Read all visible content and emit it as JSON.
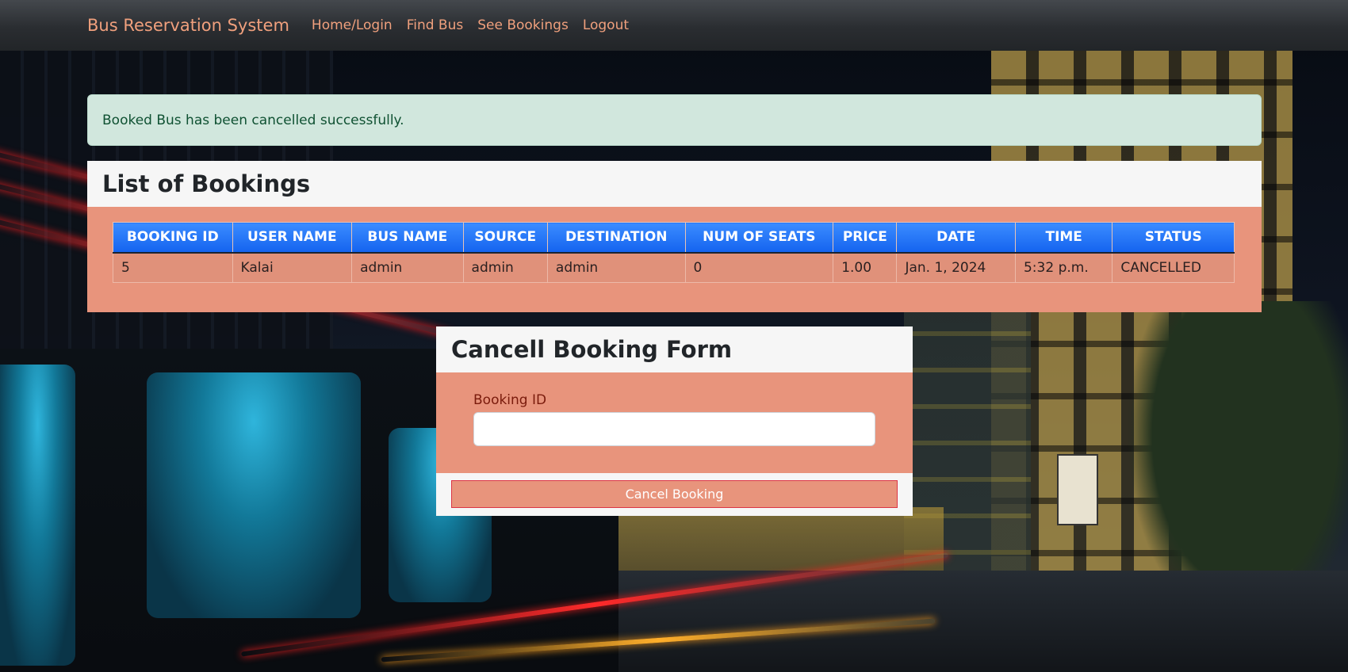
{
  "navbar": {
    "brand": "Bus Reservation System",
    "links": [
      "Home/Login",
      "Find Bus",
      "See Bookings",
      "Logout"
    ]
  },
  "alert": {
    "message": "Booked Bus has been cancelled successfully."
  },
  "bookings": {
    "title": "List of Bookings",
    "columns": [
      "BOOKING ID",
      "USER NAME",
      "BUS NAME",
      "SOURCE",
      "DESTINATION",
      "NUM OF SEATS",
      "PRICE",
      "DATE",
      "TIME",
      "STATUS"
    ],
    "rows": [
      [
        "5",
        "Kalai",
        "admin",
        "admin",
        "admin",
        "0",
        "1.00",
        "Jan. 1, 2024",
        "5:32 p.m.",
        "CANCELLED"
      ]
    ]
  },
  "cancel_form": {
    "title": "Cancell Booking Form",
    "field_label": "Booking ID",
    "field_value": "",
    "button_label": "Cancel Booking"
  },
  "colors": {
    "navbar_link": "#f0a07d",
    "card_body": "#e8947c",
    "table_header": "#1463ef",
    "alert_bg": "#d1e7dd",
    "alert_text": "#0f5132"
  }
}
